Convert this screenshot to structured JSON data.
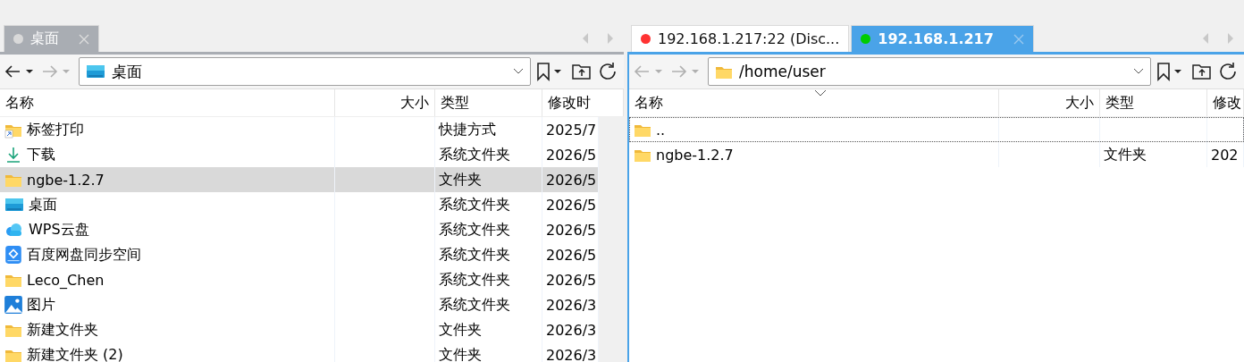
{
  "panes": [
    {
      "focused": false,
      "tabs": [
        {
          "label": "桌面",
          "selected": true,
          "color": "#d9d9d9"
        }
      ],
      "nav": {
        "back_disabled": false,
        "forward_disabled": true
      },
      "path": {
        "value": "桌面",
        "kind": "desktop"
      },
      "columns": [
        {
          "label": "名称",
          "sorted": false
        },
        {
          "label": "大小",
          "sorted": false
        },
        {
          "label": "类型",
          "sorted": false
        },
        {
          "label": "修改时",
          "sorted": false
        }
      ],
      "scrollbar": true,
      "rows": [
        {
          "kind": "shortcut",
          "name": "标签打印",
          "size": "",
          "type": "快捷方式",
          "date": "2025/7",
          "selected": false,
          "focused": false
        },
        {
          "kind": "download",
          "name": "下载",
          "type": "系统文件夹",
          "date": "2026/5",
          "selected": false,
          "focused": false
        },
        {
          "kind": "folder",
          "name": "ngbe-1.2.7",
          "type": "文件夹",
          "date": "2026/5",
          "selected": true,
          "focused": false
        },
        {
          "kind": "desktop",
          "name": "桌面",
          "type": "系统文件夹",
          "date": "2026/5",
          "selected": false,
          "focused": false
        },
        {
          "kind": "cloud",
          "name": "WPS云盘",
          "type": "系统文件夹",
          "date": "2026/5",
          "selected": false,
          "focused": false
        },
        {
          "kind": "sync",
          "name": "百度网盘同步空间",
          "type": "系统文件夹",
          "date": "2026/5",
          "selected": false,
          "focused": false
        },
        {
          "kind": "folder",
          "name": "Leco_Chen",
          "type": "系统文件夹",
          "date": "2026/5",
          "selected": false,
          "focused": false
        },
        {
          "kind": "pictures",
          "name": "图片",
          "type": "系统文件夹",
          "date": "2026/3",
          "selected": false,
          "focused": false
        },
        {
          "kind": "folder",
          "name": "新建文件夹",
          "type": "文件夹",
          "date": "2026/3",
          "selected": false,
          "focused": false
        },
        {
          "kind": "folder",
          "name": "新建文件夹 (2)",
          "type": "文件夹",
          "date": "2026/3",
          "selected": false,
          "focused": false
        }
      ]
    },
    {
      "focused": true,
      "tabs": [
        {
          "label": "192.168.1.217:22 (Disc...",
          "selected": false,
          "color": "#ff3333"
        },
        {
          "label": "192.168.1.217",
          "selected": true,
          "color": "#00cc00"
        }
      ],
      "nav": {
        "back_disabled": true,
        "forward_disabled": true
      },
      "path": {
        "value": "/home/user",
        "kind": "folder"
      },
      "columns": [
        {
          "label": "名称",
          "sorted": true
        },
        {
          "label": "大小",
          "sorted": false
        },
        {
          "label": "类型",
          "sorted": false
        },
        {
          "label": "修改",
          "sorted": false
        }
      ],
      "scrollbar": false,
      "rows": [
        {
          "kind": "folder",
          "name": "..",
          "type": "",
          "date": "",
          "selected": false,
          "focused": true
        },
        {
          "kind": "folder",
          "name": "ngbe-1.2.7",
          "type": "文件夹",
          "date": "202",
          "selected": false,
          "focused": false
        }
      ]
    }
  ]
}
